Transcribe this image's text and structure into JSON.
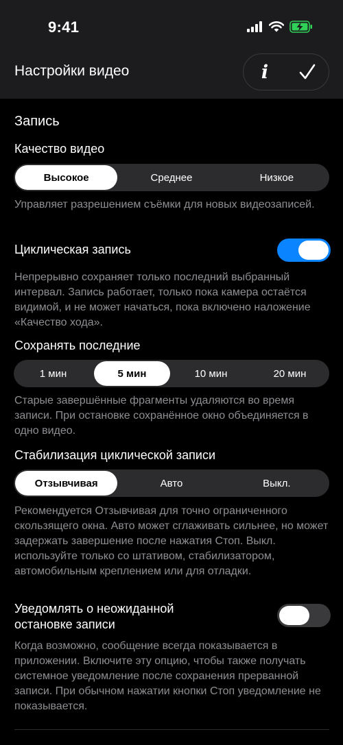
{
  "status_bar": {
    "time": "9:41"
  },
  "nav": {
    "title": "Настройки видео"
  },
  "recording": {
    "section_title": "Запись",
    "video_quality": {
      "label": "Качество видео",
      "options": [
        "Высокое",
        "Среднее",
        "Низкое"
      ],
      "selected": "Высокое",
      "description": "Управляет разрешением съёмки для новых видеозаписей."
    },
    "loop_recording": {
      "label": "Циклическая запись",
      "enabled": true,
      "description": "Непрерывно сохраняет только последний выбранный интервал. Запись работает, только пока камера остаётся видимой, и не может начаться, пока включено наложение «Качество хода»."
    },
    "keep_last": {
      "label": "Сохранять последние",
      "options": [
        "1 мин",
        "5 мин",
        "10 мин",
        "20 мин"
      ],
      "selected": "5 мин",
      "description": "Старые завершённые фрагменты удаляются во время записи. При остановке сохранённое окно объединяется в одно видео."
    },
    "stabilization": {
      "label": "Стабилизация циклической записи",
      "options": [
        "Отзывчивая",
        "Авто",
        "Выкл."
      ],
      "selected": "Отзывчивая",
      "description": "Рекомендуется Отзывчивая для точно ограниченного скользящего окна. Авто может сглаживать сильнее, но может задержать завершение после нажатия Стоп. Выкл. используйте только со штативом, стабилизатором, автомобильным креплением или для отладки."
    },
    "notify_stop": {
      "label_line1": "Уведомлять о неожиданной",
      "label_line2": "остановке записи",
      "enabled": false,
      "description": "Когда возможно, сообщение всегда показывается в приложении. Включите эту опцию, чтобы также получать системное уведомление после сохранения прерванной записи. При обычном нажатии кнопки Стоп уведомление не показывается."
    }
  },
  "colors": {
    "accent": "#0a84ff",
    "background": "#000000",
    "secondary_text": "#8e8e93",
    "battery_green": "#30d158"
  }
}
